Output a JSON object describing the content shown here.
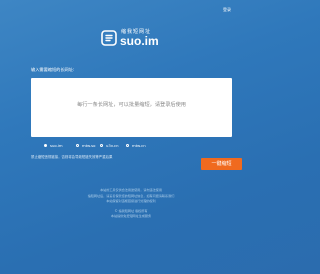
{
  "header": {
    "login_label": "登录"
  },
  "logo": {
    "cn": "缩我短网址",
    "en": "suo.im"
  },
  "form": {
    "label": "输入需要缩短的长网址:",
    "placeholder": "每行一条长网址，可以批量缩短，请登录后使用",
    "domains": [
      {
        "label": "suo.im",
        "selected": true
      },
      {
        "label": "mtw.so",
        "selected": false
      },
      {
        "label": "u3v.cn",
        "selected": false
      },
      {
        "label": "mtw.cn",
        "selected": false
      }
    ],
    "notice": "禁止缩短违规链接，否则将会导致短链失效等严重后果",
    "submit_label": "一键缩短"
  },
  "footer": {
    "lines": [
      "本站的工具仅供合法用途使用，请勿违法使用",
      "缩短网址后，请妥善保管您的短网址信息，如有问题请联系我们",
      "本站保留对违规链接进行处理的权利",
      "",
      "© 缩我短网址 版权所有",
      "本站提供免费短网址生成服务"
    ]
  }
}
